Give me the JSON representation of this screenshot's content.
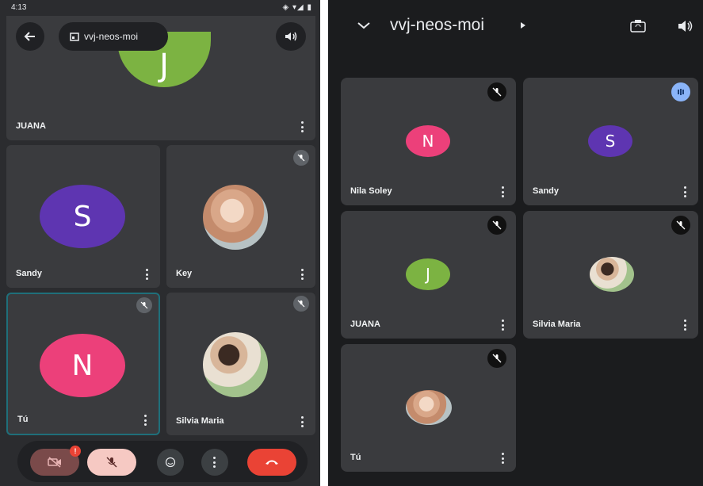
{
  "left_screen": {
    "status_bar": {
      "time": "4:13",
      "icons_right": "◈ ▾◢ ▮"
    },
    "meeting_name": "vvj-neos-moi",
    "tiles": [
      {
        "name": "JUANA",
        "initial": "J",
        "color": "#7cb342"
      },
      {
        "name": "Sandy",
        "initial": "S",
        "color": "#5e35b1"
      },
      {
        "name": "Key",
        "initial": ""
      },
      {
        "name": "Tú",
        "initial": "N",
        "color": "#ec407a"
      },
      {
        "name": "Silvia Maria",
        "initial": ""
      }
    ],
    "controls": {
      "camera_badge": "!"
    }
  },
  "right_screen": {
    "meeting_name": "vvj-neos-moi",
    "tiles": [
      {
        "name": "Nila Soley",
        "initial": "N",
        "color": "#ec407a"
      },
      {
        "name": "Sandy",
        "initial": "S",
        "color": "#5e35b1"
      },
      {
        "name": "JUANA",
        "initial": "J",
        "color": "#7cb342"
      },
      {
        "name": "Silvia Maria",
        "initial": ""
      },
      {
        "name": "Tú",
        "initial": ""
      }
    ]
  }
}
